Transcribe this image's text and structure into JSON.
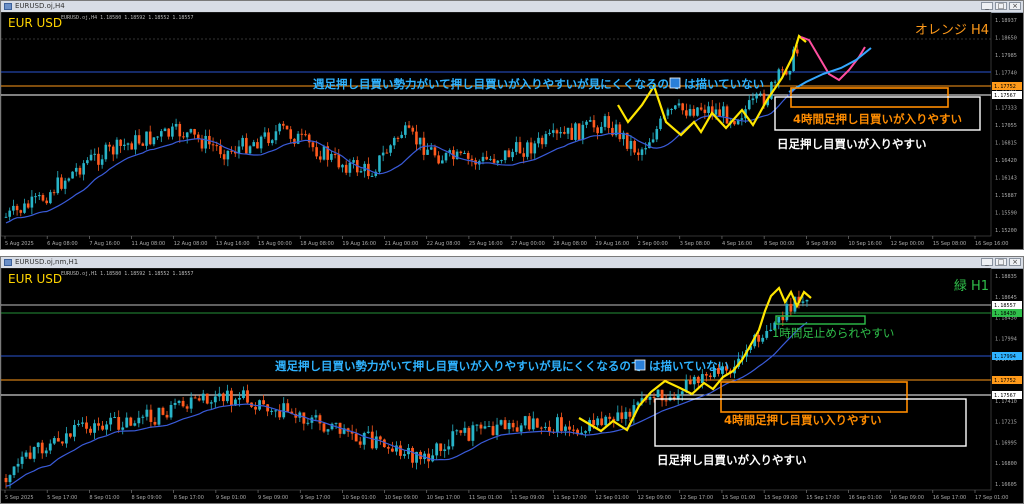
{
  "windows": [
    {
      "title": "EURUSD.oj,H4",
      "ohlc_line": "EURUSD.oj,H4  1.18580 1.18592 1.18552 1.18557",
      "symbol": "EUR USD",
      "corner_label": "オレンジ H4",
      "corner_color": "#ff9a1a",
      "notes": [
        {
          "text": "週足押し目買い勢力がいて押し目買いが入りやすいが見にくくなるので",
          "color": "#2fb3ff"
        },
        {
          "text": "は描いていない",
          "color": "#2fb3ff"
        },
        {
          "text": "4時間足押し目買いが入りやすい",
          "color": "#ff8c00"
        },
        {
          "text": "日足押し目買いが入りやすい",
          "color": "#ffffff"
        }
      ],
      "price_axis": [
        "1.18937",
        "1.18650",
        "1.17985",
        "1.17740",
        "1.17567",
        "1.17333",
        "1.17055",
        "1.16815",
        "1.16420",
        "1.16143",
        "1.15887",
        "1.15590",
        "1.15200"
      ],
      "price_tags": [
        {
          "text": "1.17752",
          "color": "#ff9a1a"
        },
        {
          "text": "1.17567",
          "color": "#ffffff"
        }
      ],
      "time_axis": [
        "5 Aug 2025",
        "6 Aug 08:00",
        "7 Aug 16:00",
        "11 Aug 08:00",
        "12 Aug 08:00",
        "13 Aug 16:00",
        "15 Aug 00:00",
        "18 Aug 08:00",
        "19 Aug 16:00",
        "21 Aug 00:00",
        "22 Aug 08:00",
        "25 Aug 16:00",
        "27 Aug 00:00",
        "28 Aug 08:00",
        "29 Aug 16:00",
        "2 Sep 00:00",
        "3 Sep 08:00",
        "4 Sep 16:00",
        "8 Sep 00:00",
        "9 Sep 08:00",
        "10 Sep 16:00",
        "12 Sep 00:00",
        "15 Sep 08:00",
        "16 Sep 16:00"
      ],
      "colors": {
        "bull": "#28b4c8",
        "bear": "#ff5a1e",
        "ma": "#3a5bd9",
        "projection_pink": "#ff4fa0",
        "projection_blue": "#35a8ff",
        "zigzag": "#ffe600"
      }
    },
    {
      "title": "EURUSD.oj,nm,H1",
      "ohlc_line": "EURUSD.oj,H1  1.18580 1.18592 1.18552 1.18557",
      "symbol": "EUR USD",
      "corner_label": "緑 H1",
      "corner_color": "#2fbf4a",
      "notes": [
        {
          "text": "週足押し目買い勢力がいて押し目買いが入りやすいが見にくくなるので",
          "color": "#2fb3ff"
        },
        {
          "text": "は描いていない",
          "color": "#2fb3ff"
        },
        {
          "text": "1時間足止められやすい",
          "color": "#2fbf4a"
        },
        {
          "text": "4時間足押し目買い入りやすい",
          "color": "#ff8c00"
        },
        {
          "text": "日足押し目買いが入りやすい",
          "color": "#ffffff"
        }
      ],
      "price_axis": [
        "1.18835",
        "1.18645",
        "1.18430",
        "1.17994",
        "1.17787",
        "1.17605",
        "1.17410",
        "1.17215",
        "1.16995",
        "1.16800",
        "1.16605"
      ],
      "price_tags": [
        {
          "text": "1.18557",
          "color": "#ffffff"
        },
        {
          "text": "1.18430",
          "color": "#2fbf4a"
        },
        {
          "text": "1.17994",
          "color": "#2fb3ff"
        },
        {
          "text": "1.17752",
          "color": "#ff9a1a"
        },
        {
          "text": "1.17567",
          "color": "#ffffff"
        }
      ],
      "time_axis": [
        "5 Sep 2025",
        "5 Sep 17:00",
        "8 Sep 01:00",
        "8 Sep 09:00",
        "8 Sep 17:00",
        "9 Sep 01:00",
        "9 Sep 09:00",
        "9 Sep 17:00",
        "10 Sep 01:00",
        "10 Sep 09:00",
        "10 Sep 17:00",
        "11 Sep 01:00",
        "11 Sep 09:00",
        "11 Sep 17:00",
        "12 Sep 01:00",
        "12 Sep 09:00",
        "12 Sep 17:00",
        "15 Sep 01:00",
        "15 Sep 09:00",
        "15 Sep 17:00",
        "16 Sep 01:00",
        "16 Sep 09:00",
        "16 Sep 17:00",
        "17 Sep 01:00"
      ],
      "colors": {
        "bull": "#28b4c8",
        "bear": "#ff5a1e",
        "ma": "#3a5bd9",
        "zigzag": "#ffe600"
      }
    }
  ]
}
